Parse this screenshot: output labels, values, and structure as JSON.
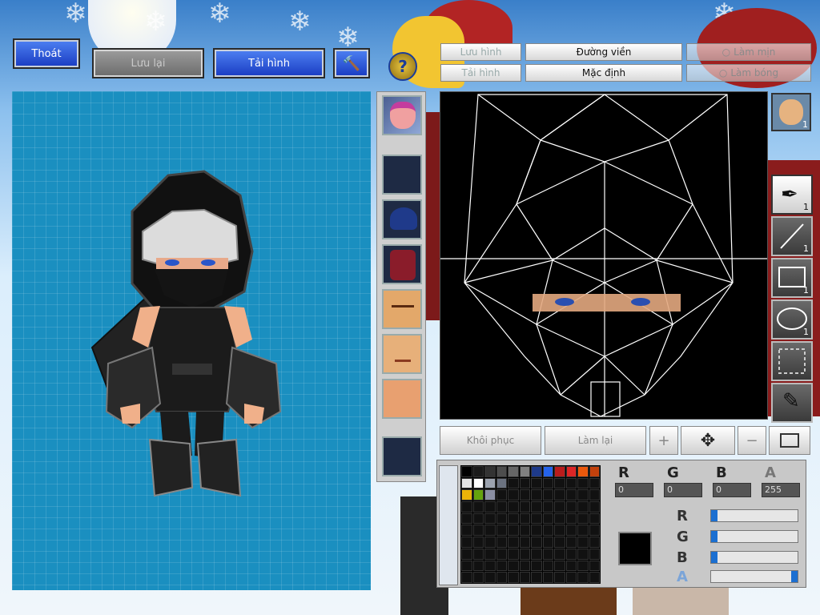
{
  "top_buttons": {
    "exit": "Thoát",
    "save": "Lưu lại",
    "reload": "Tải hình"
  },
  "editor_tabs": {
    "save_image": "Lưu hình",
    "load_image": "Tải hình",
    "outline": "Đường viền",
    "default": "Mặc định",
    "smooth": "Làm mịn",
    "shadow": "Làm bóng"
  },
  "tools": [
    {
      "name": "brush",
      "count": "1"
    },
    {
      "name": "line",
      "count": "1"
    },
    {
      "name": "rectangle",
      "count": "1"
    },
    {
      "name": "ellipse",
      "count": "1"
    },
    {
      "name": "select",
      "count": ""
    },
    {
      "name": "eyedropper",
      "count": ""
    }
  ],
  "face_badge_count": "1",
  "actions": {
    "restore": "Khôi phục",
    "redo": "Làm lại"
  },
  "color": {
    "labels": [
      "R",
      "G",
      "B",
      "A"
    ],
    "r": "0",
    "g": "0",
    "b": "0",
    "a": "255",
    "current": "#000000"
  },
  "palette_colors": [
    "#000000",
    "#1a1a1a",
    "#333333",
    "#4d4d4d",
    "#666666",
    "#808080",
    "#1e3a8a",
    "#2563eb",
    "#b91c1c",
    "#dc2626",
    "#ea580c",
    "#c2410c",
    "#e5e5e5",
    "#ffffff",
    "#9ca3af",
    "#6b7280",
    "#111111",
    "#111111",
    "#111111",
    "#111111",
    "#111111",
    "#111111",
    "#111111",
    "#111111",
    "#eab308",
    "#65a30d",
    "#8b8fa3",
    "#111111",
    "#111111",
    "#111111",
    "#111111",
    "#111111",
    "#111111",
    "#111111",
    "#111111",
    "#111111"
  ]
}
